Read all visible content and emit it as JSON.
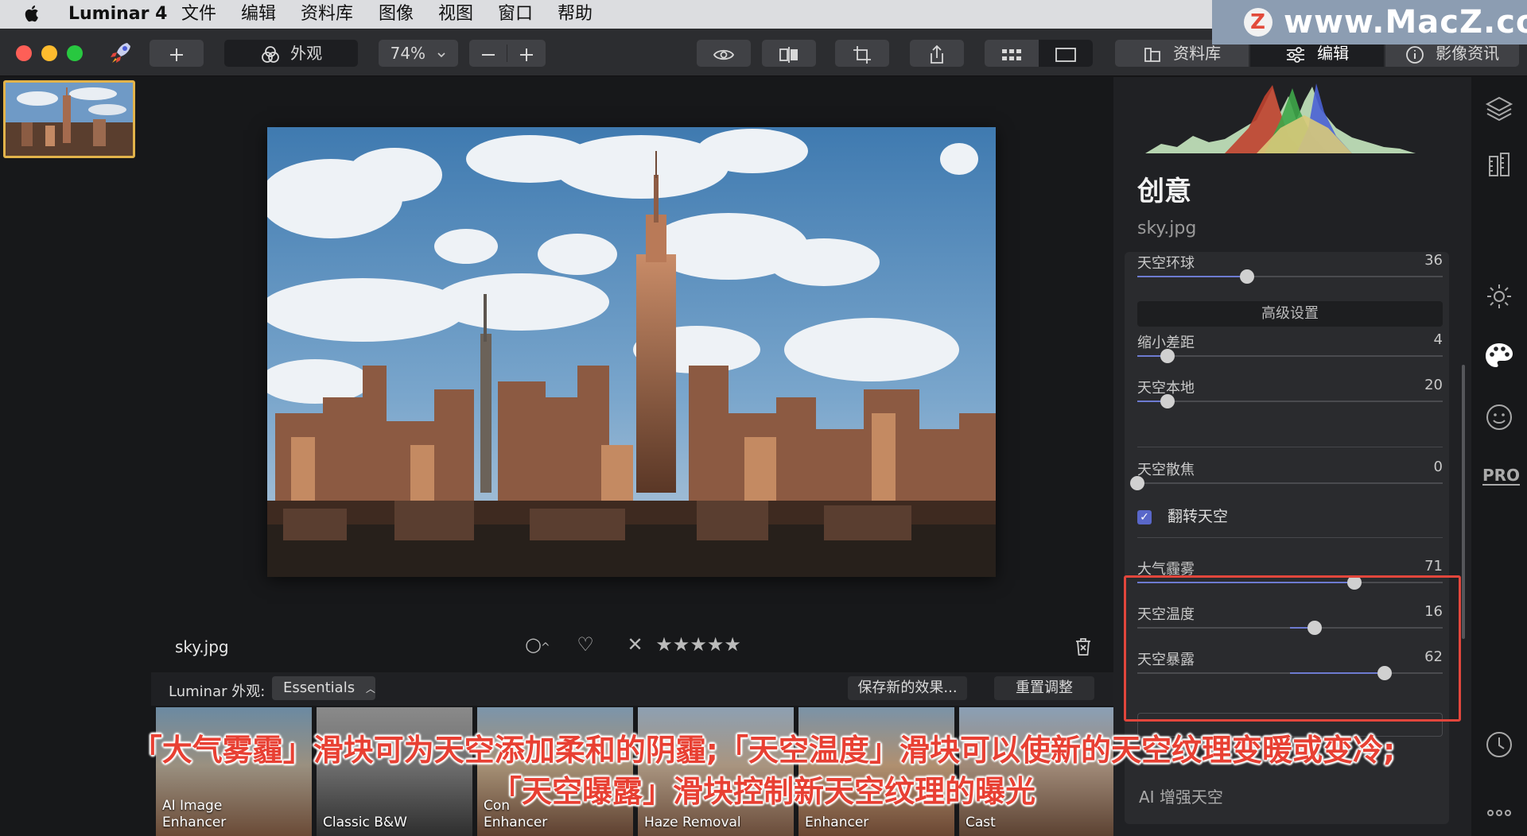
{
  "menubar": {
    "app_name": "Luminar 4",
    "items": [
      "文件",
      "编辑",
      "资料库",
      "图像",
      "视图",
      "窗口",
      "帮助"
    ]
  },
  "watermark": {
    "text": "www.MacZ.com",
    "logo": "Z"
  },
  "toolbar": {
    "looks_label": "外观",
    "zoom": "74%",
    "library_tab": "资料库",
    "edit_tab": "编辑",
    "info_tab": "影像资讯"
  },
  "viewer": {
    "filename": "sky.jpg"
  },
  "looks": {
    "label": "Luminar 外观:",
    "category": "Essentials",
    "save_button": "保存新的效果...",
    "reset_button": "重置调整",
    "items": [
      {
        "line1": "AI Image",
        "line2": "Enhancer"
      },
      {
        "line1": "Classic B&W",
        "line2": ""
      },
      {
        "line1": "Con",
        "line2": "Enhancer"
      },
      {
        "line1": "Haze Removal",
        "line2": ""
      },
      {
        "line1": "Enhancer",
        "line2": ""
      },
      {
        "line1": "Cast",
        "line2": ""
      }
    ]
  },
  "panel": {
    "title": "创意",
    "filename": "sky.jpg",
    "advanced_button": "高级设置",
    "flip_label": "翻转天空",
    "flip_checked": true,
    "ai_sky_label": "AI 增强天空",
    "sliders": {
      "global": {
        "label": "天空环球",
        "value": "36",
        "fraction": 0.36
      },
      "reduce_gap": {
        "label": "缩小差距",
        "value": "4",
        "fraction": 0.1
      },
      "sky_local": {
        "label": "天空本地",
        "value": "20",
        "fraction": 0.1
      },
      "defocus": {
        "label": "天空散焦",
        "value": "0",
        "fraction": 0.0
      },
      "haze": {
        "label": "大气霾雾",
        "value": "71",
        "fraction": 0.71
      },
      "temperature": {
        "label": "天空温度",
        "value": "16",
        "fraction": 0.58
      },
      "exposure": {
        "label": "天空暴露",
        "value": "62",
        "fraction": 0.81
      }
    }
  },
  "side_icons": {
    "pro_label": "PRO"
  },
  "subtitle": {
    "line1": "「大气雾霾」滑块可为天空添加柔和的阴霾;「天空温度」滑块可以使新的天空纹理变暖或变冷;",
    "line2": "「天空曝露」滑块控制新天空纹理的曝光"
  },
  "colors": {
    "accent": "#6d7bd1",
    "highlight_box": "#e2463c",
    "subtitle": "#e84033",
    "thumbnail_border": "#e2b34a"
  }
}
